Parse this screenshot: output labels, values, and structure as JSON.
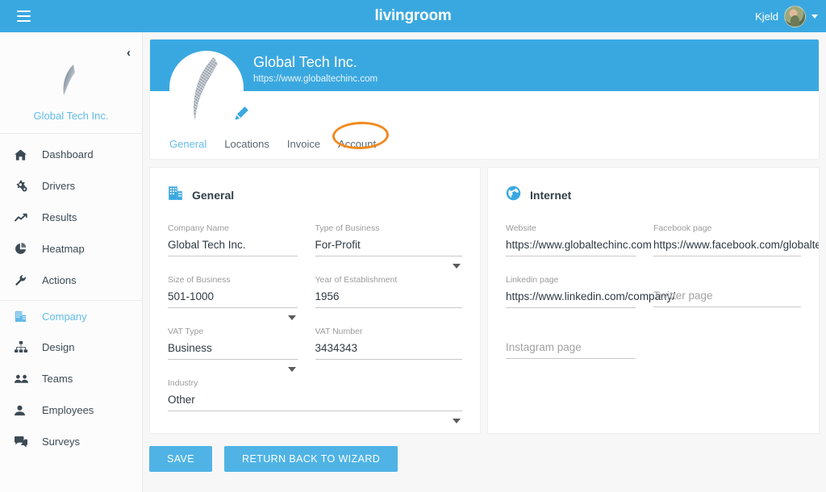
{
  "topbar": {
    "menu_icon": "hamburger-icon",
    "brand": "livingroom",
    "user_name": "Kjeld",
    "avatar_icon": "user-avatar",
    "caret_icon": "chevron-down-icon"
  },
  "sidebar": {
    "collapse_icon": "chevron-left-icon",
    "collapse_glyph": "‹",
    "company_name": "Global Tech Inc.",
    "logo_icon": "company-logo",
    "items": [
      {
        "label": "Dashboard",
        "icon": "home-icon",
        "active": false,
        "divider": false
      },
      {
        "label": "Drivers",
        "icon": "gears-icon",
        "active": false,
        "divider": false
      },
      {
        "label": "Results",
        "icon": "trendline-icon",
        "active": false,
        "divider": false
      },
      {
        "label": "Heatmap",
        "icon": "piechart-icon",
        "active": false,
        "divider": false
      },
      {
        "label": "Actions",
        "icon": "wrench-icon",
        "active": false,
        "divider": false
      },
      {
        "label": "Company",
        "icon": "building-icon",
        "active": true,
        "divider": true
      },
      {
        "label": "Design",
        "icon": "sitemap-icon",
        "active": false,
        "divider": false
      },
      {
        "label": "Teams",
        "icon": "people-icon",
        "active": false,
        "divider": false
      },
      {
        "label": "Employees",
        "icon": "person-icon",
        "active": false,
        "divider": false
      },
      {
        "label": "Surveys",
        "icon": "comments-icon",
        "active": false,
        "divider": false
      }
    ]
  },
  "banner": {
    "company_name": "Global Tech Inc.",
    "website_url": "https://www.globaltechinc.com",
    "logo_icon": "company-logo",
    "edit_icon": "pencil-icon",
    "tabs": [
      {
        "label": "General",
        "active": true
      },
      {
        "label": "Locations",
        "active": false
      },
      {
        "label": "Invoice",
        "active": false
      },
      {
        "label": "Account",
        "active": false
      }
    ],
    "highlight_target": "Account",
    "highlight_color": "#f18a21"
  },
  "general_card": {
    "title": "General",
    "icon": "building-icon",
    "fields": {
      "company_name": {
        "label": "Company Name",
        "value": "Global Tech Inc.",
        "type": "text"
      },
      "business_type": {
        "label": "Type of Business",
        "value": "For-Profit",
        "type": "select"
      },
      "business_size": {
        "label": "Size of Business",
        "value": "501-1000",
        "type": "select"
      },
      "year_founded": {
        "label": "Year of Establishment",
        "value": "1956",
        "type": "text"
      },
      "vat_type": {
        "label": "VAT Type",
        "value": "Business",
        "type": "select"
      },
      "vat_number": {
        "label": "VAT Number",
        "value": "3434343",
        "type": "text"
      },
      "industry": {
        "label": "Industry",
        "value": "Other",
        "type": "select"
      }
    }
  },
  "internet_card": {
    "title": "Internet",
    "icon": "globe-icon",
    "fields": {
      "website": {
        "label": "Website",
        "value": "https://www.globaltechinc.com",
        "placeholder": ""
      },
      "facebook": {
        "label": "Facebook page",
        "value": "https://www.facebook.com/globaltechinc",
        "placeholder": ""
      },
      "linkedin": {
        "label": "Linkedin page",
        "value": "https://www.linkedin.com/company/",
        "placeholder": ""
      },
      "twitter": {
        "label": "",
        "value": "",
        "placeholder": "Twitter page"
      },
      "instagram": {
        "label": "",
        "value": "",
        "placeholder": "Instagram page"
      }
    }
  },
  "actions": {
    "save_label": "SAVE",
    "wizard_label": "RETURN BACK TO WIZARD"
  },
  "colors": {
    "primary": "#3aa8e0",
    "button": "#4fb3e5",
    "accent_link": "#63bbe8",
    "highlight": "#f18a21",
    "page_bg": "#f7f7f7"
  }
}
